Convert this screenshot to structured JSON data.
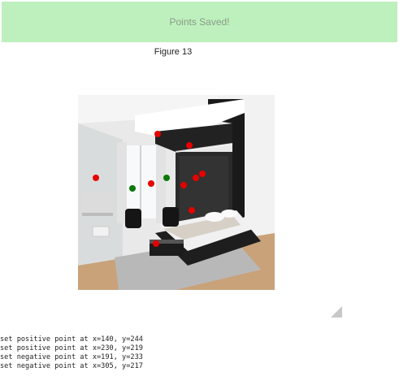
{
  "banner": {
    "text": "Points Saved!",
    "background": "#bdf0bd",
    "text_color": "#8a9a8a"
  },
  "figure": {
    "title": "Figure 13"
  },
  "image": {
    "subject": "modern bedroom interior",
    "markers": {
      "positive_color": "#0a7a0a",
      "negative_color": "#e60000",
      "positive_count": 2,
      "negative_count": 10
    }
  },
  "log": {
    "lines": [
      "set positive point at x=140, y=244",
      "set positive point at x=230, y=219",
      "set negative point at x=191, y=233",
      "set negative point at x=305, y=217"
    ]
  },
  "resize_handle": {
    "icon": "resize-grip-icon"
  }
}
